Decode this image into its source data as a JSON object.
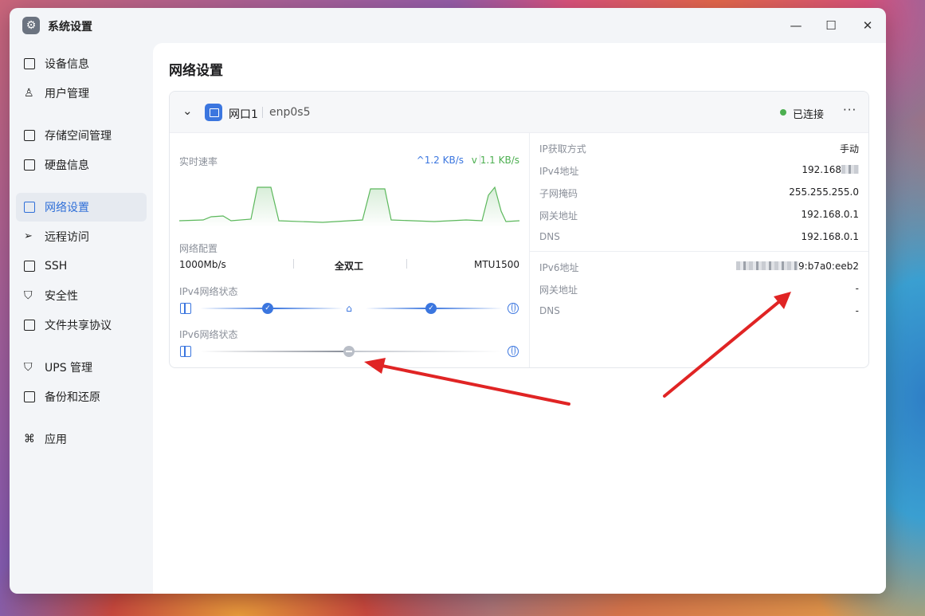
{
  "window": {
    "title": "系统设置",
    "app_icon": "gear-icon"
  },
  "controls": {
    "minimize": "—",
    "maximize": "☐",
    "close": "✕"
  },
  "sidebar": {
    "items": [
      {
        "label": "设备信息",
        "icon": "device-icon",
        "active": false
      },
      {
        "label": "用户管理",
        "icon": "user-icon",
        "active": false
      },
      {
        "label": "存储空间管理",
        "icon": "storage-icon",
        "active": false
      },
      {
        "label": "硬盘信息",
        "icon": "disk-icon",
        "active": false
      },
      {
        "label": "网络设置",
        "icon": "network-icon",
        "active": true
      },
      {
        "label": "远程访问",
        "icon": "send-icon",
        "active": false
      },
      {
        "label": "SSH",
        "icon": "terminal-icon",
        "active": false
      },
      {
        "label": "安全性",
        "icon": "shield-icon",
        "active": false
      },
      {
        "label": "文件共享协议",
        "icon": "file-icon",
        "active": false
      },
      {
        "label": "UPS 管理",
        "icon": "ups-shield-icon",
        "active": false
      },
      {
        "label": "备份和还原",
        "icon": "backup-icon",
        "active": false
      },
      {
        "label": "应用",
        "icon": "apps-icon",
        "active": false
      }
    ]
  },
  "page": {
    "title": "网络设置"
  },
  "port": {
    "name": "网口1",
    "device": "enp0s5",
    "status": "已连接",
    "more": "···"
  },
  "realtime": {
    "label": "实时速率",
    "upload": "^1.2 KB/s",
    "download": "v 1.1 KB/s"
  },
  "config": {
    "label": "网络配置",
    "speed": "1000Mb/s",
    "duplex": "全双工",
    "mtu": "MTU1500"
  },
  "ipv4_status": {
    "label": "IPv4网络状态"
  },
  "ipv6_status": {
    "label": "IPv6网络状态"
  },
  "ipv4_info": [
    {
      "key": "IP获取方式",
      "value": "手动"
    },
    {
      "key": "IPv4地址",
      "value": "192.168"
    },
    {
      "key": "子网掩码",
      "value": "255.255.255.0"
    },
    {
      "key": "网关地址",
      "value": "192.168.0.1"
    },
    {
      "key": "DNS",
      "value": "192.168.0.1"
    }
  ],
  "ipv6_info": [
    {
      "key": "IPv6地址",
      "value": "9:b7a0:eeb2"
    },
    {
      "key": "网关地址",
      "value": "-"
    },
    {
      "key": "DNS",
      "value": "-"
    }
  ],
  "colors": {
    "accent": "#3b76df",
    "connected": "#4caf50",
    "annotation": "#e02424"
  }
}
